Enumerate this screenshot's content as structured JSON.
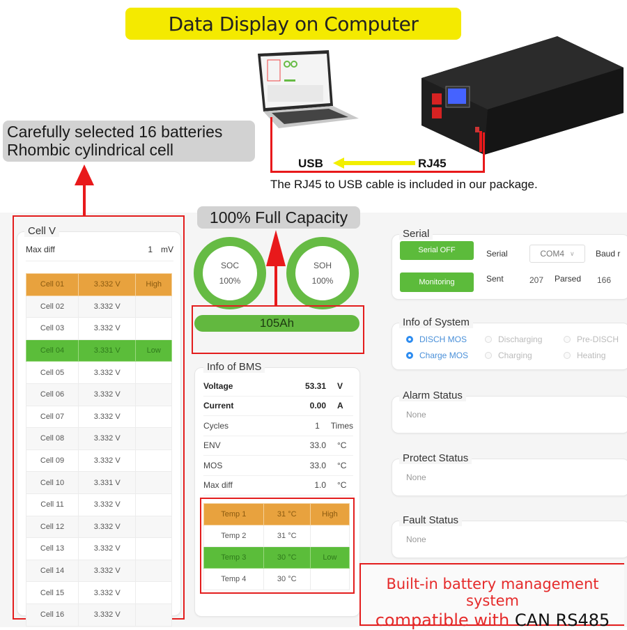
{
  "banner": {
    "title": "Data Display on Computer"
  },
  "callouts": {
    "cells_line1": "Carefully selected 16 batteries",
    "cells_line2": "Rhombic cylindrical cell",
    "capacity": "100% Full Capacity",
    "bms_line1": "Built-in battery management system",
    "bms_line2_prefix": "compatible with ",
    "bms_line2_suffix": "CAN RS485"
  },
  "connection": {
    "usb_label": "USB",
    "rj45_label": "RJ45",
    "note": "The RJ45 to USB cable is included in our package."
  },
  "colors": {
    "high": "#e8a23e",
    "low": "#5bbd3a",
    "ring": "#66bb44",
    "accent_red": "#e31d1d",
    "banner_yellow": "#f4ea00",
    "radio_on": "#2d8cf0"
  },
  "cell_v": {
    "legend": "Cell V",
    "max_diff_label": "Max diff",
    "max_diff_value": "1",
    "max_diff_unit": "mV",
    "rows": [
      {
        "name": "Cell 01",
        "voltage": "3.332 V",
        "flag": "High",
        "state": "high"
      },
      {
        "name": "Cell 02",
        "voltage": "3.332 V",
        "flag": "",
        "state": "alt"
      },
      {
        "name": "Cell 03",
        "voltage": "3.332 V",
        "flag": "",
        "state": ""
      },
      {
        "name": "Cell 04",
        "voltage": "3.331 V",
        "flag": "Low",
        "state": "low"
      },
      {
        "name": "Cell 05",
        "voltage": "3.332 V",
        "flag": "",
        "state": ""
      },
      {
        "name": "Cell 06",
        "voltage": "3.332 V",
        "flag": "",
        "state": "alt"
      },
      {
        "name": "Cell 07",
        "voltage": "3.332 V",
        "flag": "",
        "state": ""
      },
      {
        "name": "Cell 08",
        "voltage": "3.332 V",
        "flag": "",
        "state": "alt"
      },
      {
        "name": "Cell 09",
        "voltage": "3.332 V",
        "flag": "",
        "state": ""
      },
      {
        "name": "Cell 10",
        "voltage": "3.331 V",
        "flag": "",
        "state": "alt"
      },
      {
        "name": "Cell 11",
        "voltage": "3.332 V",
        "flag": "",
        "state": ""
      },
      {
        "name": "Cell 12",
        "voltage": "3.332 V",
        "flag": "",
        "state": "alt"
      },
      {
        "name": "Cell 13",
        "voltage": "3.332 V",
        "flag": "",
        "state": ""
      },
      {
        "name": "Cell 14",
        "voltage": "3.332 V",
        "flag": "",
        "state": "alt"
      },
      {
        "name": "Cell 15",
        "voltage": "3.332 V",
        "flag": "",
        "state": ""
      },
      {
        "name": "Cell 16",
        "voltage": "3.332 V",
        "flag": "",
        "state": "alt"
      }
    ]
  },
  "gauges": {
    "soc": {
      "label": "SOC",
      "value": "100%"
    },
    "soh": {
      "label": "SOH",
      "value": "100%"
    },
    "capacity": "105Ah"
  },
  "bms": {
    "legend": "Info of BMS",
    "rows": [
      {
        "key": "Voltage",
        "value": "53.31",
        "unit": "V",
        "bold": true
      },
      {
        "key": "Current",
        "value": "0.00",
        "unit": "A",
        "bold": true
      },
      {
        "key": "Cycles",
        "value": "1",
        "unit": "Times",
        "bold": false
      },
      {
        "key": "ENV",
        "value": "33.0",
        "unit": "°C",
        "bold": false
      },
      {
        "key": "MOS",
        "value": "33.0",
        "unit": "°C",
        "bold": false
      },
      {
        "key": "Max diff",
        "value": "1.0",
        "unit": "°C",
        "bold": false
      }
    ],
    "temps": [
      {
        "name": "Temp 1",
        "value": "31 °C",
        "flag": "High",
        "state": "high"
      },
      {
        "name": "Temp 2",
        "value": "31 °C",
        "flag": "",
        "state": ""
      },
      {
        "name": "Temp 3",
        "value": "30 °C",
        "flag": "Low",
        "state": "low"
      },
      {
        "name": "Temp 4",
        "value": "30 °C",
        "flag": "",
        "state": ""
      }
    ]
  },
  "serial": {
    "legend": "Serial",
    "serial_off_button": "Serial OFF",
    "monitoring_button": "Monitoring",
    "port_label": "Serial",
    "port_value": "COM4",
    "baud_label": "Baud r",
    "sent_label": "Sent",
    "sent_value": "207",
    "parsed_label": "Parsed",
    "parsed_value": "166"
  },
  "system": {
    "legend": "Info of System",
    "items": [
      {
        "label": "DISCH MOS",
        "on": true
      },
      {
        "label": "Discharging",
        "on": false
      },
      {
        "label": "Pre-DISCH",
        "on": false
      },
      {
        "label": "Charge MOS",
        "on": true
      },
      {
        "label": "Charging",
        "on": false
      },
      {
        "label": "Heating",
        "on": false
      }
    ]
  },
  "alarm": {
    "legend": "Alarm Status",
    "value": "None"
  },
  "protect": {
    "legend": "Protect Status",
    "value": "None"
  },
  "fault": {
    "legend": "Fault Status",
    "value": "None"
  }
}
